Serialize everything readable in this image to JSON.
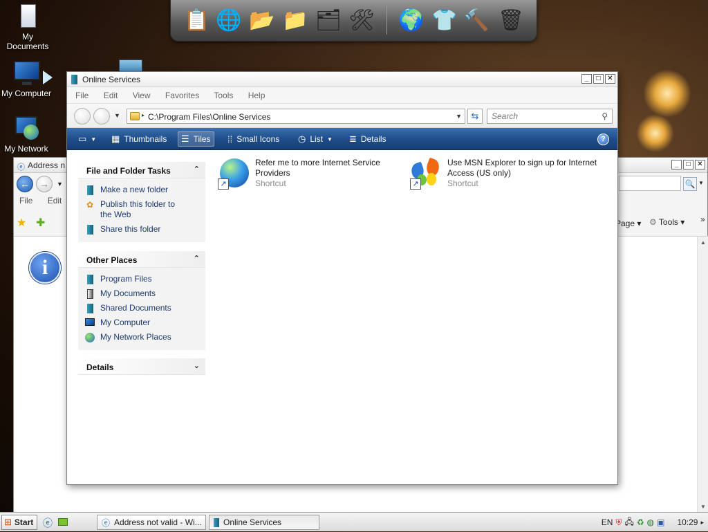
{
  "desktop": {
    "icons": [
      {
        "label": "My Documents"
      },
      {
        "label": "My Computer"
      },
      {
        "label": "My Network"
      }
    ]
  },
  "back_window": {
    "title": "Address n",
    "menus": [
      "File",
      "Edit"
    ],
    "toolbar": {
      "page": "Page",
      "tools": "Tools"
    }
  },
  "window": {
    "title": "Online Services",
    "menus": [
      "File",
      "Edit",
      "View",
      "Favorites",
      "Tools",
      "Help"
    ],
    "address": {
      "path": "C:\\Program Files\\Online Services"
    },
    "search": {
      "placeholder": "Search"
    },
    "commands": {
      "thumbnails": "Thumbnails",
      "tiles": "Tiles",
      "small_icons": "Small Icons",
      "list": "List",
      "details": "Details"
    },
    "taskpane": {
      "file_tasks": {
        "title": "File and Folder Tasks",
        "items": [
          "Make a new folder",
          "Publish this folder to the Web",
          "Share this folder"
        ]
      },
      "other_places": {
        "title": "Other Places",
        "items": [
          "Program Files",
          "My Documents",
          "Shared Documents",
          "My Computer",
          "My Network Places"
        ]
      },
      "details": {
        "title": "Details"
      }
    },
    "files": [
      {
        "name": "Refer me to more Internet Service Providers",
        "type": "Shortcut",
        "icon": "globe-icon"
      },
      {
        "name": "Use MSN Explorer to sign up for Internet Access (US only)",
        "type": "Shortcut",
        "icon": "msn-butterfly-icon"
      }
    ]
  },
  "taskbar": {
    "start": "Start",
    "buttons": [
      "Address not valid - Wi...",
      "Online Services"
    ],
    "language": "EN",
    "clock": "10:29"
  }
}
